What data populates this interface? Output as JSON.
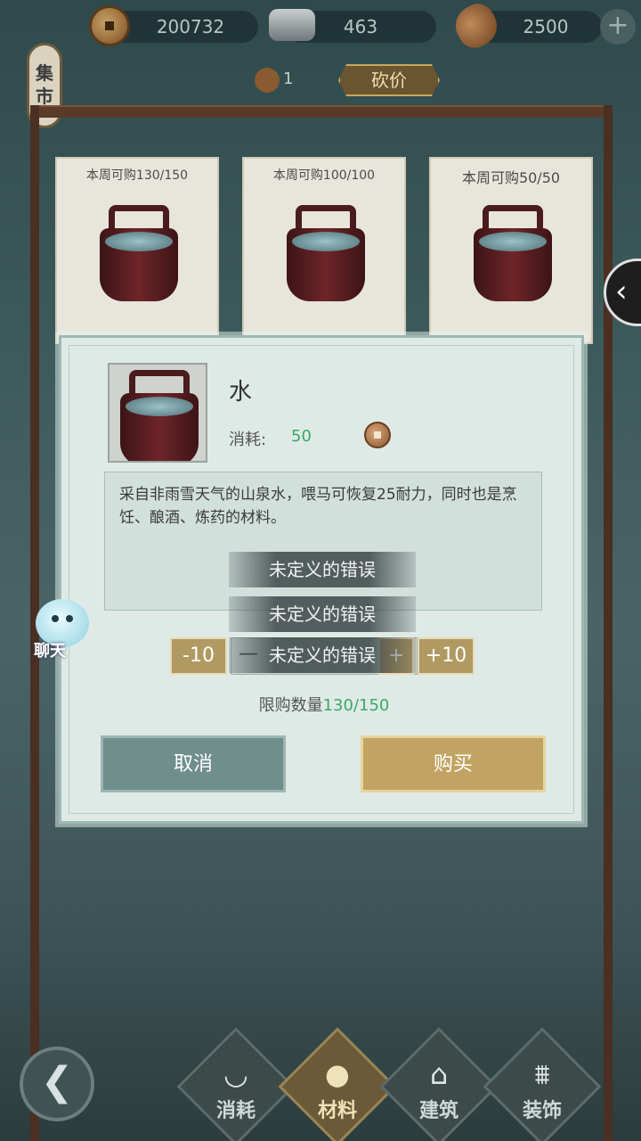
{
  "currencies": [
    {
      "name": "copper-coin",
      "value": "200732"
    },
    {
      "name": "silver-ingot",
      "value": "463"
    },
    {
      "name": "seed",
      "value": "2500"
    }
  ],
  "plus": "+",
  "market_sign": [
    "集",
    "市"
  ],
  "lantern_count": "1",
  "discount_label": "砍价",
  "shop_cards": [
    {
      "limit": "本周可购130/150"
    },
    {
      "limit": "本周可购100/100"
    },
    {
      "limit": "本周可购50/50"
    }
  ],
  "side_tab_icon": "chevron-left",
  "side_tab_glyph": "‹",
  "modal": {
    "item_name": "水",
    "cost_label": "消耗:",
    "cost_value": "50",
    "description": "采自非雨雪天气的山泉水，喂马可恢复25耐力，同时也是烹饪、酿酒、炼药的材料。",
    "errors": [
      "未定义的错误",
      "未定义的错误",
      "未定义的错误"
    ],
    "qty": {
      "minus10": "-10",
      "minus": "—",
      "plus": "+",
      "plus10": "+10"
    },
    "limit_label": "限购数量",
    "limit_value": "130/150",
    "cancel": "取消",
    "buy": "购买"
  },
  "chat_label": "聊天",
  "back_glyph": "❮",
  "nav": [
    {
      "label": "消耗",
      "icon": "bowl-icon",
      "glyph": "◡",
      "active": false
    },
    {
      "label": "材料",
      "icon": "ingredients-icon",
      "glyph": "●",
      "active": true
    },
    {
      "label": "建筑",
      "icon": "building-icon",
      "glyph": "⌂",
      "active": false
    },
    {
      "label": "装饰",
      "icon": "gate-icon",
      "glyph": "⩩",
      "active": false
    }
  ],
  "colors": {
    "accent_green": "#3aa86a",
    "gold": "#c1a461",
    "teal": "#6f8e8c"
  }
}
